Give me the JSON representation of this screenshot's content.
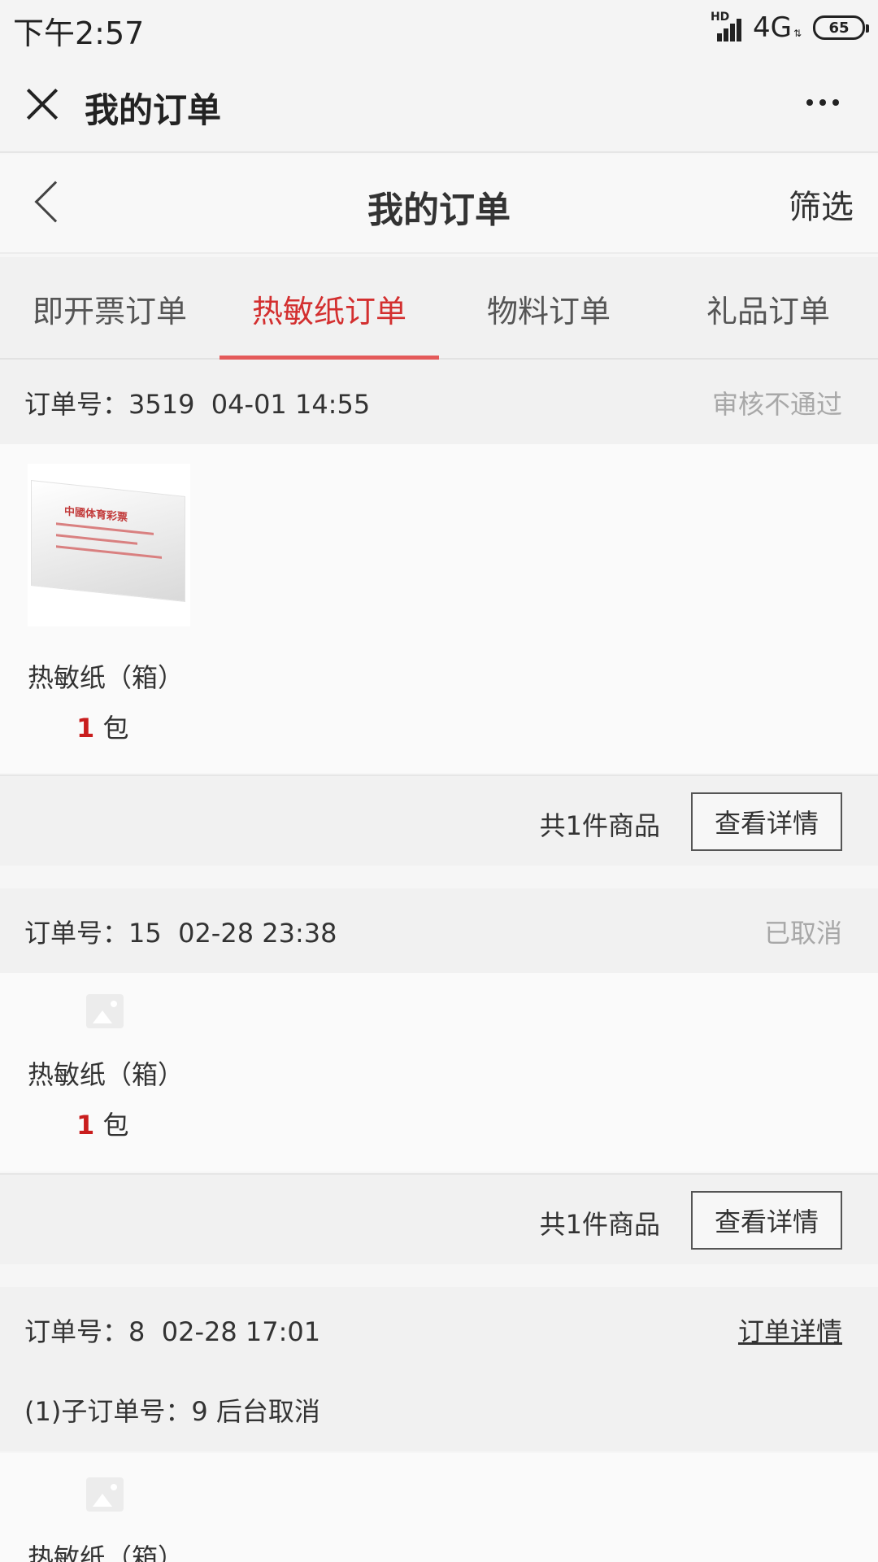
{
  "status_bar": {
    "time": "下午2:57",
    "hd": "HD",
    "network": "4G",
    "battery": "65"
  },
  "title_bar": {
    "title": "我的订单"
  },
  "page_header": {
    "title": "我的订单",
    "filter": "筛选"
  },
  "tabs": [
    {
      "label": "即开票订单",
      "active": false
    },
    {
      "label": "热敏纸订单",
      "active": true
    },
    {
      "label": "物料订单",
      "active": false
    },
    {
      "label": "礼品订单",
      "active": false
    }
  ],
  "orders": [
    {
      "number": "订单号：3519",
      "time": "04-01 14:55",
      "status": "审核不通过",
      "product": {
        "name": "热敏纸（箱）",
        "qty": "1",
        "unit": "包"
      },
      "summary": "共1件商品",
      "detail_button": "查看详情"
    },
    {
      "number": "订单号：15",
      "time": "02-28 23:38",
      "status": "已取消",
      "product": {
        "name": "热敏纸（箱）",
        "qty": "1",
        "unit": "包"
      },
      "summary": "共1件商品",
      "detail_button": "查看详情"
    },
    {
      "number": "订单号：8",
      "time": "02-28 17:01",
      "link": "订单详情",
      "sub_order": "(1)子订单号：9  后台取消",
      "product": {
        "name": "热敏纸（箱）"
      }
    }
  ],
  "product_box_text": "中國体育彩票",
  "colors": {
    "accent": "#d32f2f",
    "tab_underline": "#e45a5a",
    "status_muted": "#a8a8a8"
  }
}
